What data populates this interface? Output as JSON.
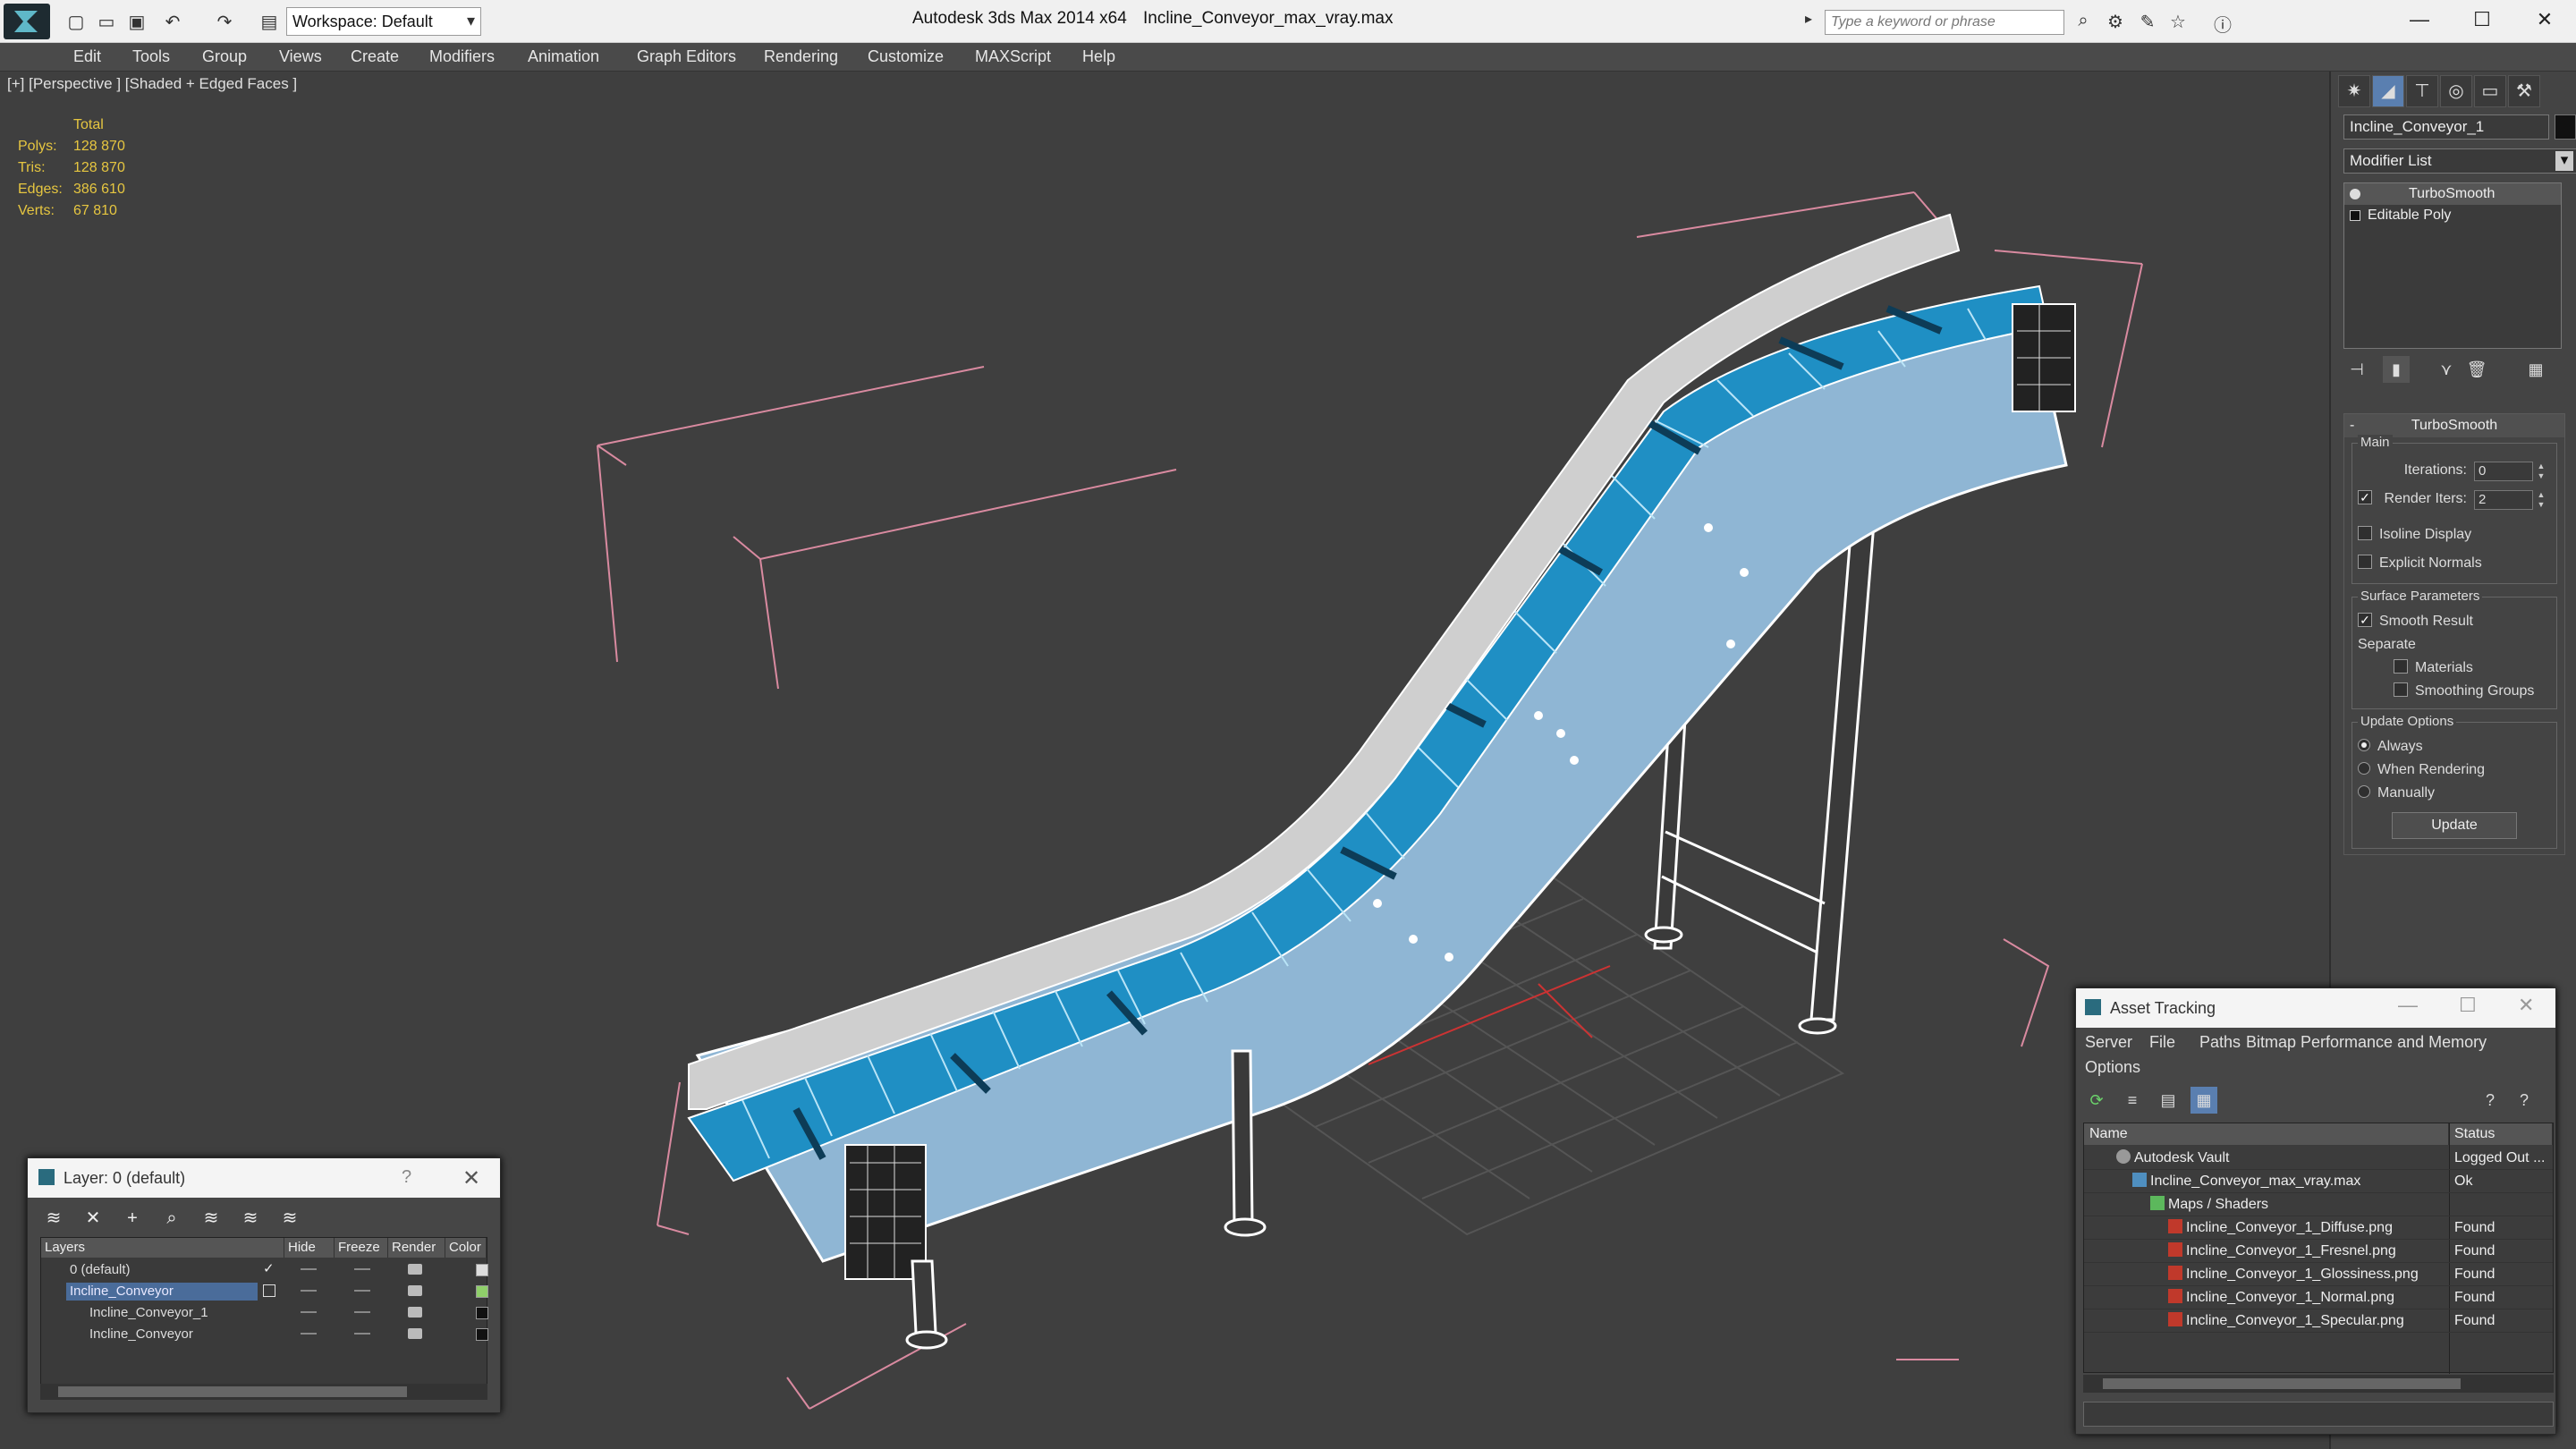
{
  "titlebar": {
    "workspace_label": "Workspace: Default",
    "app_title": "Autodesk 3ds Max  2014 x64",
    "file_title": "Incline_Conveyor_max_vray.max",
    "search_placeholder": "Type a keyword or phrase"
  },
  "menu": [
    "Edit",
    "Tools",
    "Group",
    "Views",
    "Create",
    "Modifiers",
    "Animation",
    "Graph Editors",
    "Rendering",
    "Customize",
    "MAXScript",
    "Help"
  ],
  "viewport": {
    "label": "[+] [Perspective ] [Shaded + Edged Faces ]",
    "stats": {
      "header": "Total",
      "rows": [
        {
          "label": "Polys:",
          "value": "128 870"
        },
        {
          "label": "Tris:",
          "value": "128 870"
        },
        {
          "label": "Edges:",
          "value": "386 610"
        },
        {
          "label": "Verts:",
          "value": "67 810"
        }
      ]
    }
  },
  "command_panel": {
    "object_name": "Incline_Conveyor_1",
    "modifier_list": "Modifier List",
    "stack": [
      "TurboSmooth",
      "Editable Poly"
    ],
    "rollout_title": "TurboSmooth",
    "main_group": "Main",
    "iterations_label": "Iterations:",
    "iterations_value": "0",
    "render_iters_label": "Render Iters:",
    "render_iters_value": "2",
    "isoline_label": "Isoline Display",
    "explicit_normals_label": "Explicit Normals",
    "surface_group": "Surface Parameters",
    "smooth_result_label": "Smooth Result",
    "separate_label": "Separate",
    "materials_label": "Materials",
    "smoothing_groups_label": "Smoothing Groups",
    "update_group": "Update Options",
    "always_label": "Always",
    "when_rendering_label": "When Rendering",
    "manually_label": "Manually",
    "update_button": "Update"
  },
  "layer_dialog": {
    "title": "Layer: 0 (default)",
    "help": "?",
    "columns": [
      "Layers",
      "Hide",
      "Freeze",
      "Render",
      "Color"
    ],
    "rows": [
      {
        "name": "0 (default)"
      },
      {
        "name": "Incline_Conveyor"
      },
      {
        "name": "Incline_Conveyor_1"
      },
      {
        "name": "Incline_Conveyor"
      }
    ]
  },
  "asset_dialog": {
    "title": "Asset Tracking",
    "menu": [
      "Server",
      "File",
      "Paths",
      "Bitmap Performance and Memory",
      "Options"
    ],
    "columns": [
      "Name",
      "Status"
    ],
    "rows": [
      {
        "name": "Autodesk Vault",
        "status": "Logged Out ..."
      },
      {
        "name": "Incline_Conveyor_max_vray.max",
        "status": "Ok"
      },
      {
        "name": "Maps / Shaders",
        "status": ""
      },
      {
        "name": "Incline_Conveyor_1_Diffuse.png",
        "status": "Found"
      },
      {
        "name": "Incline_Conveyor_1_Fresnel.png",
        "status": "Found"
      },
      {
        "name": "Incline_Conveyor_1_Glossiness.png",
        "status": "Found"
      },
      {
        "name": "Incline_Conveyor_1_Normal.png",
        "status": "Found"
      },
      {
        "name": "Incline_Conveyor_1_Specular.png",
        "status": "Found"
      }
    ]
  }
}
